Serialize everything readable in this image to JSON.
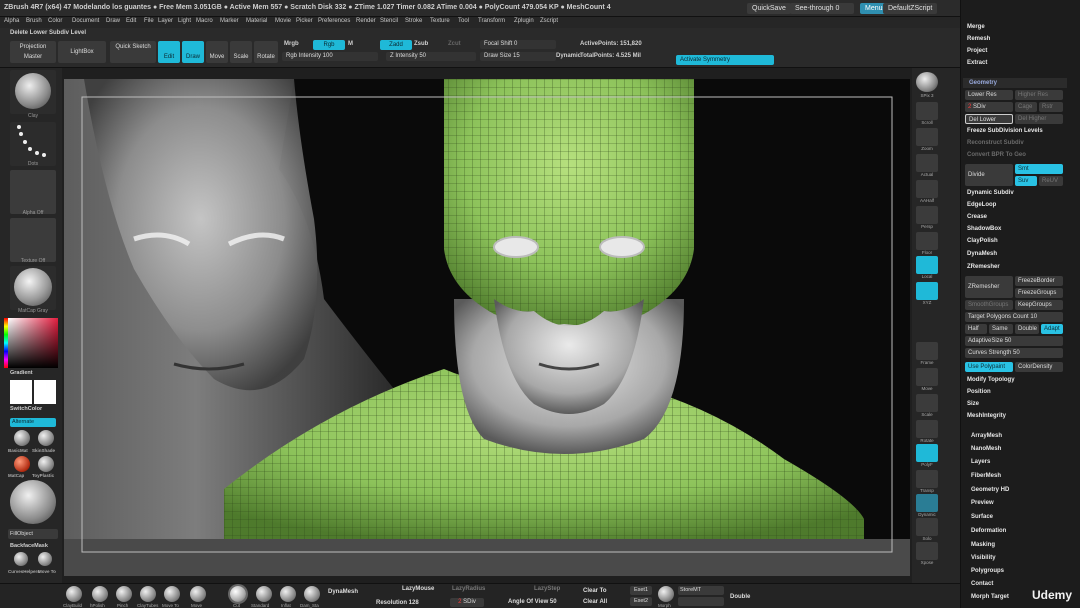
{
  "titlebar": {
    "text": "ZBrush 4R7 (x64)   47 Modelando los guantes   ● Free Mem 3.051GB ● Active Mem 557 ● Scratch Disk 332 ● ZTime 1.027 Timer 0.082 ATime 0.004 ● PolyCount 479.054 KP ● MeshCount 4",
    "quicksave": "QuickSave",
    "see_through": "See-through  0",
    "menus": "Menus",
    "default_script": "DefaultZScript"
  },
  "menubar": [
    "Alpha",
    "Brush",
    "Color",
    "Document",
    "Draw",
    "Edit",
    "File",
    "Layer",
    "Light",
    "Macro",
    "Marker",
    "Material",
    "Movie",
    "Picker",
    "Preferences",
    "Render",
    "Stencil",
    "Stroke",
    "Texture",
    "Tool",
    "Transform",
    "Zplugin",
    "Zscript"
  ],
  "toolbar": {
    "delete_lower": "Delete Lower Subdiv Level",
    "projection_master": "Projection Master",
    "lightbox": "LightBox",
    "quick_sketch": "Quick Sketch",
    "edit": "Edit",
    "draw": "Draw",
    "move": "Move",
    "scale": "Scale",
    "rotate": "Rotate",
    "mrgb": "Mrgb",
    "rgb": "Rgb",
    "m": "M",
    "zadd": "Zadd",
    "zsub": "Zsub",
    "zcut": "Zcut",
    "rgb_intensity": "Rgb Intensity 100",
    "z_intensity": "Z Intensity 50",
    "focal_shift": "Focal Shift 0",
    "draw_size": "Draw Size 15",
    "dynamic": "Dynamic",
    "active_points": "ActivePoints: 151,820",
    "total_points": "TotalPoints: 4.525 Mil",
    "activate_symmetry": "Activate Symmetry"
  },
  "leftshelf": {
    "items": [
      "Clay",
      "Dots",
      "Alpha Off",
      "Texture Off",
      "MatCap Gray"
    ],
    "gradient": "Gradient",
    "switch_color": "SwitchColor",
    "alternate": "Alternate",
    "mat1": "BasicMat",
    "mat2": "SkinShade",
    "mat3": "MatCap",
    "mat4": "ToyPlastic",
    "fill_object": "FillObject",
    "backface_mask": "BackfaceMask",
    "curves": "CurvesHelpers",
    "move_to": "Move To"
  },
  "rightshelf": [
    "SPix 3",
    "Scroll",
    "Zoom",
    "Actual",
    "AAHalf",
    "Persp",
    "Floor",
    "Local",
    "XYZ",
    "Frame",
    "Move",
    "Scale",
    "Rotate",
    "PolyF",
    "Transp",
    "Dynamic",
    "Solo",
    "Xpose"
  ],
  "rightpanel": {
    "top": [
      "Merge",
      "Remesh",
      "Project",
      "Extract"
    ],
    "geometry_header": "Geometry",
    "lower_res": "Lower Res",
    "higher_res": "Higher Res",
    "sdiv": "SDiv",
    "sdiv_value": "2",
    "cage": "Cage",
    "rstr": "Rstr",
    "del_lower": "Del Lower",
    "del_higher": "Del Higher",
    "freeze_subdiv": "Freeze SubDivision Levels",
    "reconstruct": "Reconstruct Subdiv",
    "convert_bpr": "Convert BPR To Geo",
    "divide": "Divide",
    "smt": "Smt",
    "suv": "Suv",
    "reuv": "ReUV",
    "items_a": [
      "Dynamic Subdiv",
      "EdgeLoop",
      "Crease",
      "ShadowBox",
      "ClayPolish",
      "DynaMesh",
      "ZRemesher"
    ],
    "zremesher": "ZRemesher",
    "freeze_border": "FreezeBorder",
    "freeze_groups": "FreezeGroups",
    "smooth_groups": "SmoothGroups",
    "keep_groups": "KeepGroups",
    "target_poly": "Target Polygons Count 10",
    "half": "Half",
    "same": "Same",
    "double": "Double",
    "adapt": "Adapt",
    "adaptive_size": "AdaptiveSize 50",
    "curves_strength": "Curves Strength 50",
    "use_polypaint": "Use Polypaint",
    "color_density": "ColorDensity",
    "items_b": [
      "Modify Topology",
      "Position",
      "Size",
      "MeshIntegrity"
    ],
    "items_c": [
      "ArrayMesh",
      "NanoMesh",
      "Layers",
      "FiberMesh",
      "Geometry HD",
      "Preview",
      "Surface",
      "Deformation",
      "Masking",
      "Visibility",
      "Polygroups",
      "Contact",
      "Morph Target"
    ]
  },
  "bottombar": {
    "brushes": [
      "ClayBuild",
      "hPolish",
      "Pinch",
      "ClayTubes",
      "Move To",
      "Move",
      "Cut",
      "Standard",
      "Inflat",
      "Dam_Sta"
    ],
    "dynamesh": "DynaMesh",
    "resolution": "Resolution 128",
    "lazymouse": "LazyMouse",
    "lazyradius": "LazyRadius",
    "lazystep": "LazyStep",
    "sdiv_label": "SDiv",
    "sdiv_value": "2",
    "angle": "Angle Of View 50",
    "clear_to": "Clear To",
    "clear_all": "Clear All",
    "gizmo1": "Eset1",
    "gizmo2": "Eset2",
    "morph": "Morph",
    "store_mt": "StoreMT",
    "double": "Double"
  },
  "watermark": "Udemy"
}
